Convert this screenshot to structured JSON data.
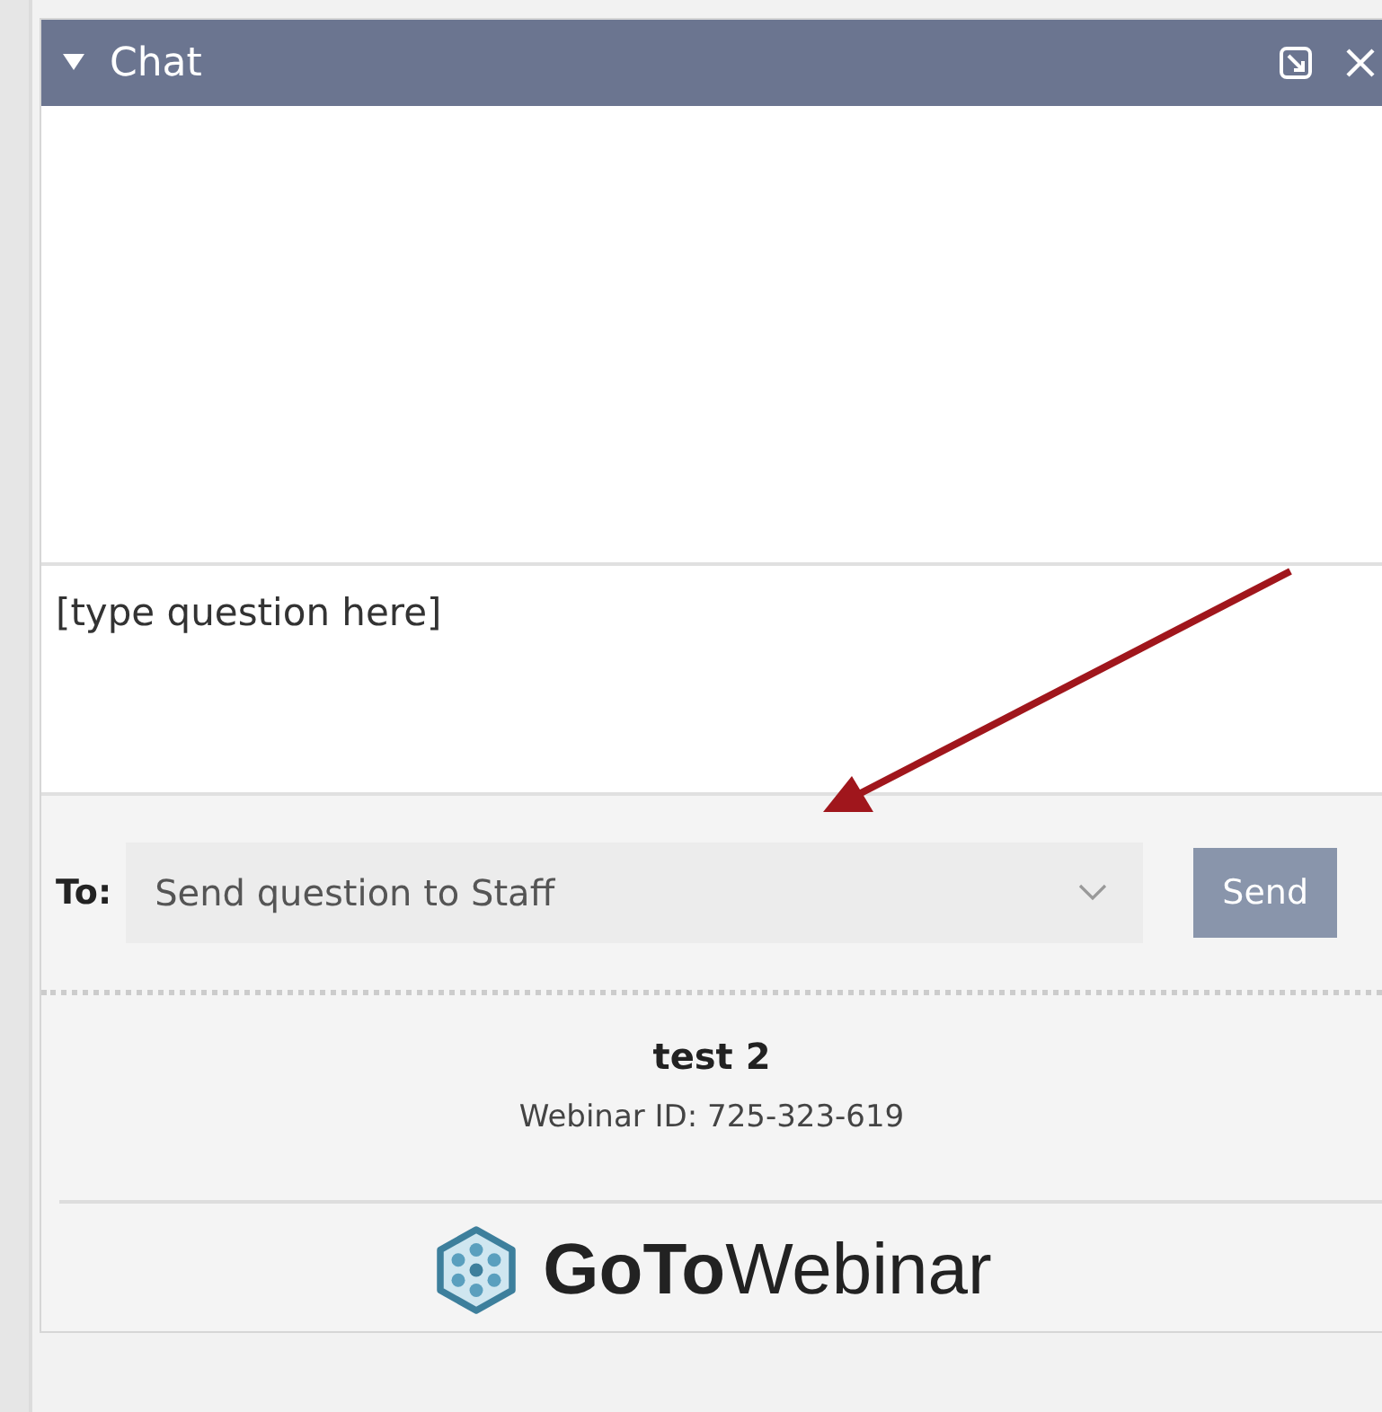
{
  "window": {
    "title": "Chat",
    "expanded": true
  },
  "question": {
    "placeholder": "[type question here]"
  },
  "recipient": {
    "label": "To:",
    "value": "Send question to Staff"
  },
  "send_button": "Send",
  "webinar": {
    "title": "test 2",
    "id": "Webinar ID: 725-323-619"
  },
  "logo": "**GoTo**Webinar"
}
